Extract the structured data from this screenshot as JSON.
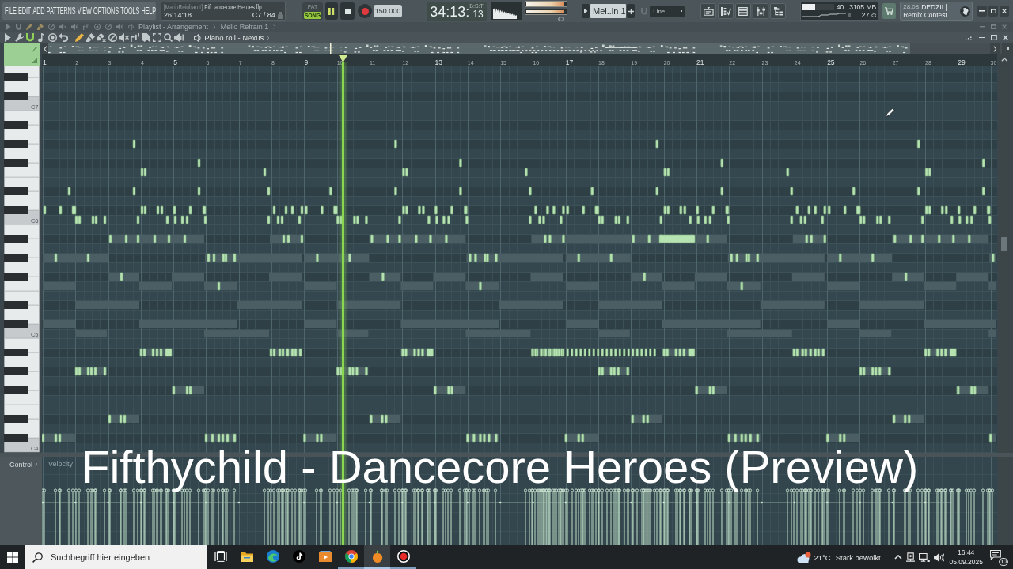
{
  "menu": [
    "FILE",
    "EDIT",
    "ADD",
    "PATTERNS",
    "VIEW",
    "OPTIONS",
    "TOOLS",
    "HELP"
  ],
  "project": {
    "user": "[MarioReinhardt]",
    "file": "Fift..ancecore Heroes.flp",
    "time": "26:14:18",
    "note": "C7 / 84"
  },
  "transport": {
    "modes": [
      {
        "label": "PAT",
        "selected": false
      },
      {
        "label": "SONG",
        "selected": true
      }
    ],
    "playing": true,
    "tempo": "150.000"
  },
  "time_display": {
    "main": "34:13:",
    "ticks": "13",
    "unit": "B:S:T"
  },
  "master_meter": [
    {
      "level": 0.96
    },
    {
      "level": 0.96
    }
  ],
  "pattern_selector": {
    "value": "Mel..in 1"
  },
  "snap": {
    "value": "Line"
  },
  "performance": {
    "level": 0.4,
    "cpu": "40",
    "memory": "3105 MB",
    "polyphony": "27"
  },
  "news": {
    "date": "28.08",
    "headline": "DEDZII |",
    "subtitle": "Remix Contest"
  },
  "playlist_bar": {
    "title": "Playlist - Arrangement",
    "pattern": "Mello Refrain 1"
  },
  "piano_roll": {
    "tools": [
      {
        "kind": "arrow",
        "selected": false
      },
      {
        "kind": "wrench",
        "selected": false
      },
      {
        "kind": "magnet",
        "selected": true
      },
      {
        "kind": "note",
        "selected": false
      },
      {
        "kind": "record-circle",
        "selected": false
      },
      {
        "kind": "undo",
        "selected": false
      },
      {
        "kind": "pencil",
        "selected": true
      },
      {
        "kind": "brush",
        "selected": false
      },
      {
        "kind": "delete",
        "selected": false
      },
      {
        "kind": "mute",
        "selected": false
      },
      {
        "kind": "volume-mute",
        "selected": false
      },
      {
        "kind": "slip",
        "selected": false
      },
      {
        "kind": "slice",
        "selected": false
      },
      {
        "kind": "select",
        "selected": false
      },
      {
        "kind": "zoom",
        "selected": false
      },
      {
        "kind": "playback",
        "selected": false
      }
    ],
    "title": "Piano roll - Nexus",
    "ruler": [
      "1",
      "2",
      "3",
      "4",
      "5",
      "6",
      "7",
      "8",
      "9",
      "10",
      "11",
      "12",
      "13",
      "14",
      "15",
      "16",
      "17",
      "18",
      "19",
      "20",
      "21",
      "22",
      "23",
      "24",
      "25",
      "26",
      "27",
      "28",
      "29",
      "30"
    ],
    "key_labels": [
      "C7",
      "C6",
      "C5",
      "C4"
    ],
    "control": {
      "label": "Control",
      "target": "Velocity"
    }
  },
  "video_title": "Fifthychild - Dancecore Heroes (Preview)",
  "taskbar": {
    "search": {
      "placeholder": "Suchbegriff hier eingeben"
    },
    "apps": [
      {
        "kind": "task-view",
        "running": false,
        "selected": false
      },
      {
        "kind": "explorer",
        "running": false,
        "selected": false
      },
      {
        "kind": "edge",
        "running": false,
        "selected": false
      },
      {
        "kind": "tiktok",
        "running": false,
        "selected": false
      },
      {
        "kind": "media",
        "running": false,
        "selected": false
      },
      {
        "kind": "chrome",
        "running": true,
        "selected": false
      },
      {
        "kind": "fl-studio",
        "running": true,
        "selected": true
      },
      {
        "kind": "recorder",
        "running": true,
        "selected": false
      }
    ],
    "weather": {
      "temp": "21°C",
      "text": "Stark bewölkt"
    },
    "clock": {
      "time": "16:44",
      "date": "05.09.2025"
    },
    "notifications": "10"
  }
}
